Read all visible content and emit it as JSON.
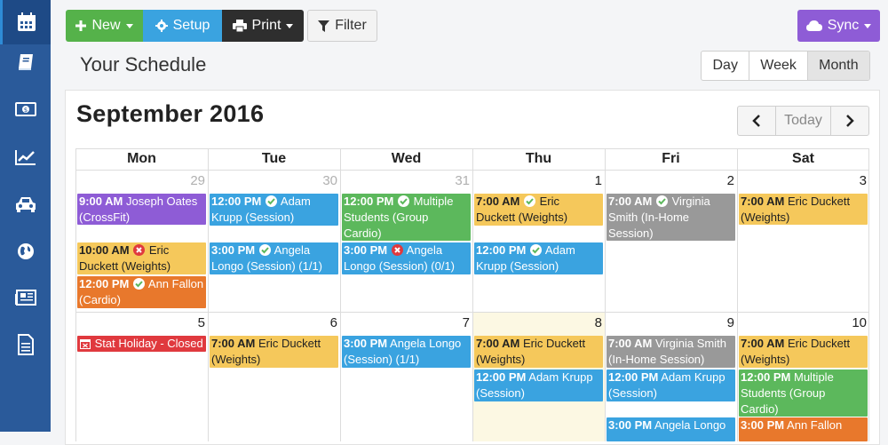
{
  "sidebar": {
    "items": [
      {
        "icon": "calendar-icon",
        "active": true
      },
      {
        "icon": "book-icon"
      },
      {
        "icon": "money-icon"
      },
      {
        "icon": "line-chart-icon"
      },
      {
        "icon": "car-icon"
      },
      {
        "icon": "globe-icon"
      },
      {
        "icon": "newspaper-icon"
      },
      {
        "icon": "document-icon"
      }
    ]
  },
  "toolbar": {
    "new_label": "New",
    "setup_label": "Setup",
    "print_label": "Print",
    "filter_label": "Filter",
    "sync_label": "Sync"
  },
  "page": {
    "title": "Your Schedule"
  },
  "views": {
    "day": "Day",
    "week": "Week",
    "month": "Month",
    "selected": "Month"
  },
  "calendar": {
    "month_title": "September 2016",
    "today_label": "Today",
    "weekdays": [
      "Mon",
      "Tue",
      "Wed",
      "Thu",
      "Fri",
      "Sat"
    ],
    "weeks": [
      {
        "days": [
          "29",
          "30",
          "31",
          "1",
          "2",
          "3"
        ]
      },
      {
        "days": [
          "5",
          "6",
          "7",
          "8",
          "9",
          "10"
        ]
      }
    ],
    "events": [
      {
        "time": "9:00 AM",
        "status": "",
        "text": "Joseph Oates (CrossFit)",
        "color": "purple"
      },
      {
        "time": "10:00 AM",
        "status": "cancelled",
        "text": "Eric Duckett (Weights)",
        "color": "yellow"
      },
      {
        "time": "12:00 PM",
        "status": "confirmed",
        "text": "Ann Fallon (Cardio)",
        "color": "orange"
      },
      {
        "time": "12:00 PM",
        "status": "confirmed",
        "text": "Adam Krupp (Session)",
        "color": "blue"
      },
      {
        "time": "3:00 PM",
        "status": "confirmed",
        "text": "Angela Longo (Session) (1/1)",
        "color": "blue"
      },
      {
        "time": "12:00 PM",
        "status": "confirmed",
        "text": "Multiple Students (Group Cardio)",
        "color": "green"
      },
      {
        "time": "3:00 PM",
        "status": "cancelled",
        "text": "Angela Longo (Session) (0/1)",
        "color": "blue"
      },
      {
        "time": "7:00 AM",
        "status": "confirmed",
        "text": "Eric Duckett (Weights)",
        "color": "yellow"
      },
      {
        "time": "12:00 PM",
        "status": "confirmed",
        "text": "Adam Krupp (Session)",
        "color": "blue"
      },
      {
        "time": "7:00 AM",
        "status": "confirmed",
        "text": "Virginia Smith (In-Home Session)",
        "color": "gray"
      },
      {
        "time": "7:00 AM",
        "status": "",
        "text": "Eric Duckett (Weights)",
        "color": "yellow"
      },
      {
        "time": "",
        "status": "holiday",
        "text": "Stat Holiday - Closed",
        "color": "red"
      },
      {
        "time": "7:00 AM",
        "status": "",
        "text": "Eric Duckett (Weights)",
        "color": "yellow"
      },
      {
        "time": "3:00 PM",
        "status": "",
        "text": "Angela Longo (Session) (1/1)",
        "color": "blue"
      },
      {
        "time": "7:00 AM",
        "status": "",
        "text": "Eric Duckett (Weights)",
        "color": "yellow"
      },
      {
        "time": "12:00 PM",
        "status": "",
        "text": "Adam Krupp (Session)",
        "color": "blue"
      },
      {
        "time": "7:00 AM",
        "status": "",
        "text": "Virginia Smith (In-Home Session)",
        "color": "gray"
      },
      {
        "time": "12:00 PM",
        "status": "",
        "text": "Adam Krupp (Session)",
        "color": "blue"
      },
      {
        "time": "3:00 PM",
        "status": "",
        "text": "Angela Longo",
        "color": "blue"
      },
      {
        "time": "7:00 AM",
        "status": "",
        "text": "Eric Duckett (Weights)",
        "color": "yellow"
      },
      {
        "time": "12:00 PM",
        "status": "",
        "text": "Multiple Students (Group Cardio)",
        "color": "green"
      },
      {
        "time": "3:00 PM",
        "status": "",
        "text": "Ann Fallon",
        "color": "orange"
      }
    ]
  },
  "colors": {
    "sidebar": "#2a5a9a",
    "new": "#55b24a",
    "setup": "#3aa3e0",
    "print": "#2e2e2e",
    "sync": "#8e5cd6",
    "today_highlight": "#fcf8e3"
  }
}
